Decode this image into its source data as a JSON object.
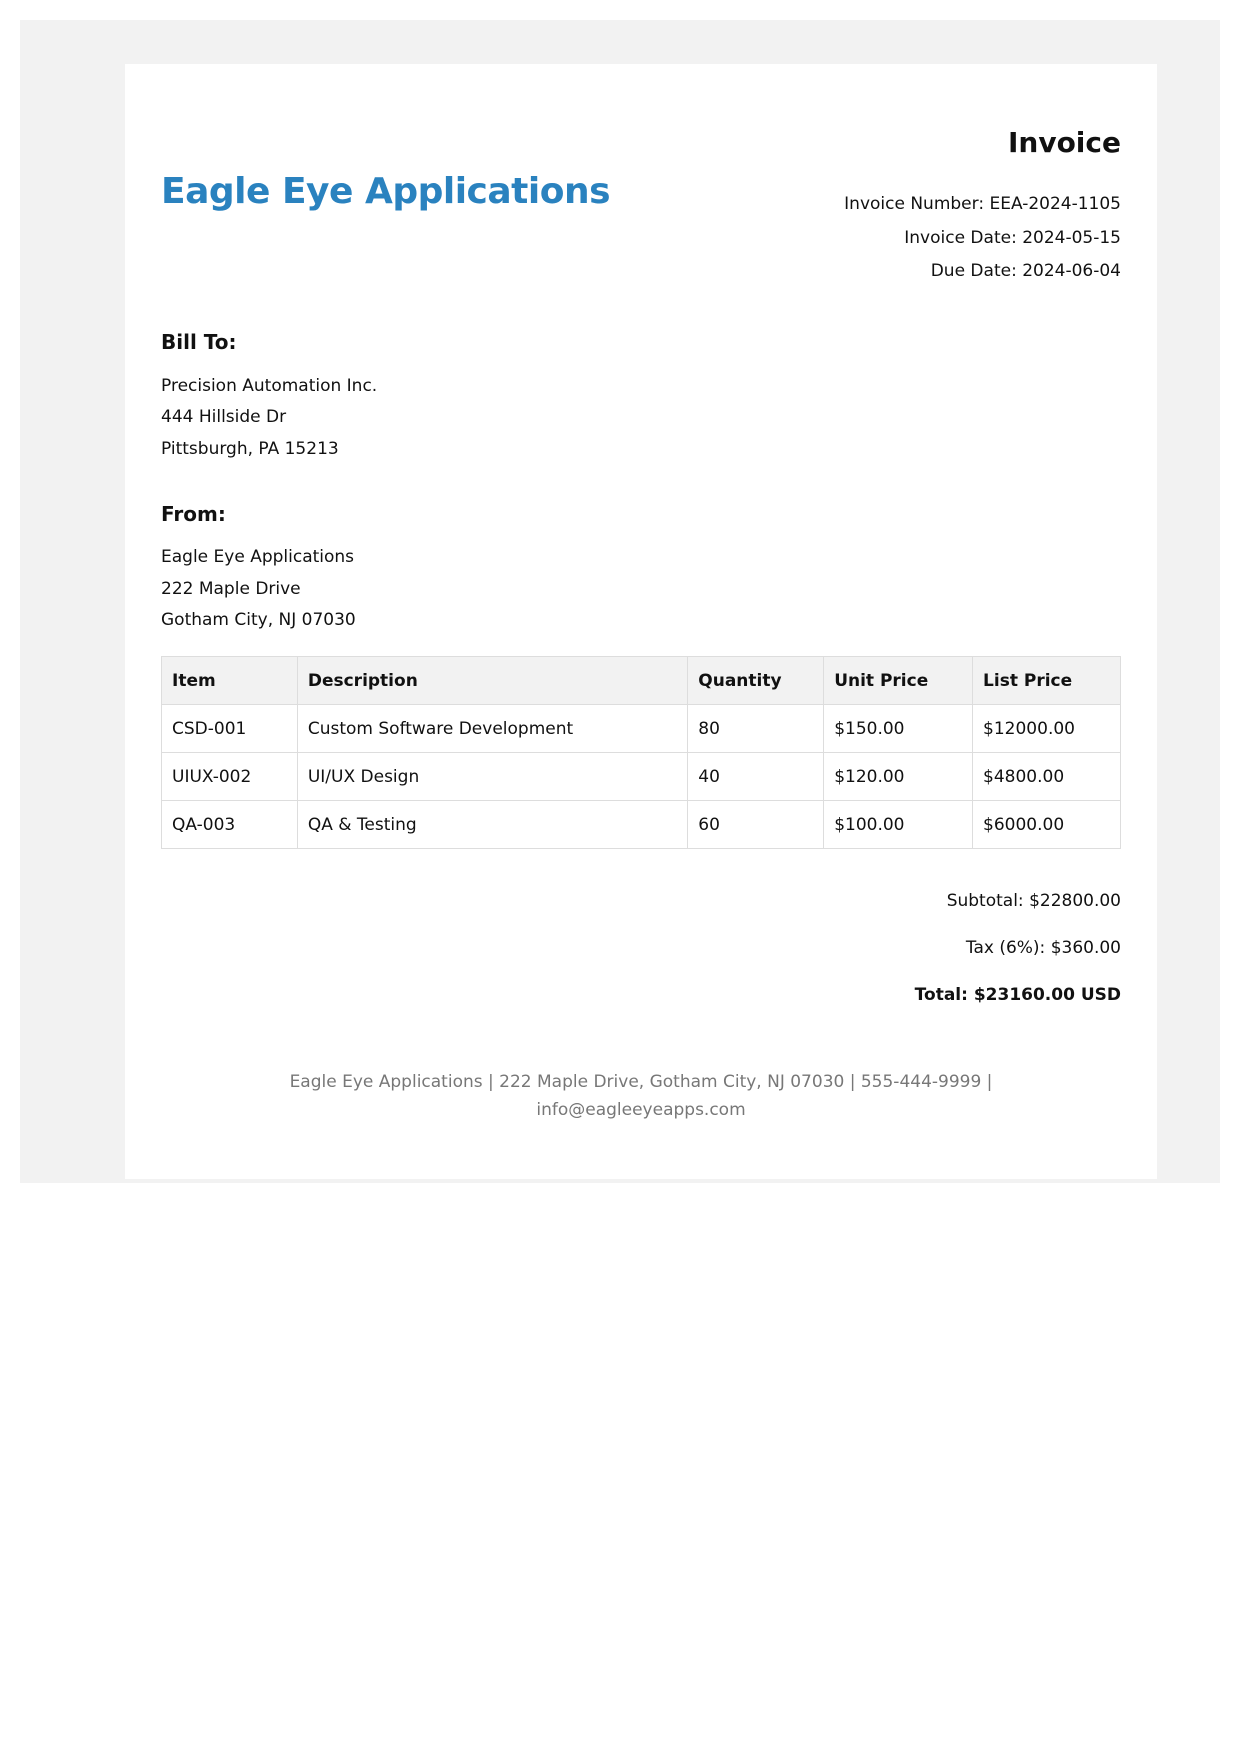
{
  "company_name": "Eagle Eye Applications",
  "invoice": {
    "title": "Invoice",
    "number": "Invoice Number: EEA-2024-1105",
    "date": "Invoice Date: 2024-05-15",
    "due_date": "Due Date: 2024-06-04"
  },
  "bill_to": {
    "heading": "Bill To:",
    "lines": [
      "Precision Automation Inc.",
      "444 Hillside Dr",
      "Pittsburgh, PA 15213"
    ]
  },
  "from": {
    "heading": "From:",
    "lines": [
      "Eagle Eye Applications",
      "222 Maple Drive",
      "Gotham City, NJ 07030"
    ]
  },
  "table": {
    "headers": [
      "Item",
      "Description",
      "Quantity",
      "Unit Price",
      "List Price"
    ],
    "rows": [
      [
        "CSD-001",
        "Custom Software Development",
        "80",
        "$150.00",
        "$12000.00"
      ],
      [
        "UIUX-002",
        "UI/UX Design",
        "40",
        "$120.00",
        "$4800.00"
      ],
      [
        "QA-003",
        "QA & Testing",
        "60",
        "$100.00",
        "$6000.00"
      ]
    ]
  },
  "totals": {
    "subtotal": "Subtotal: $22800.00",
    "tax": "Tax (6%): $360.00",
    "total": "Total: $23160.00 USD"
  },
  "footer": {
    "line1": "Eagle Eye Applications | 222 Maple Drive, Gotham City, NJ 07030 | 555-444-9999 |",
    "line2": "info@eagleeyeapps.com"
  },
  "colors": {
    "brand": "#2a82bf",
    "page_bg": "#f2f2f2",
    "footer_text": "#777777"
  }
}
